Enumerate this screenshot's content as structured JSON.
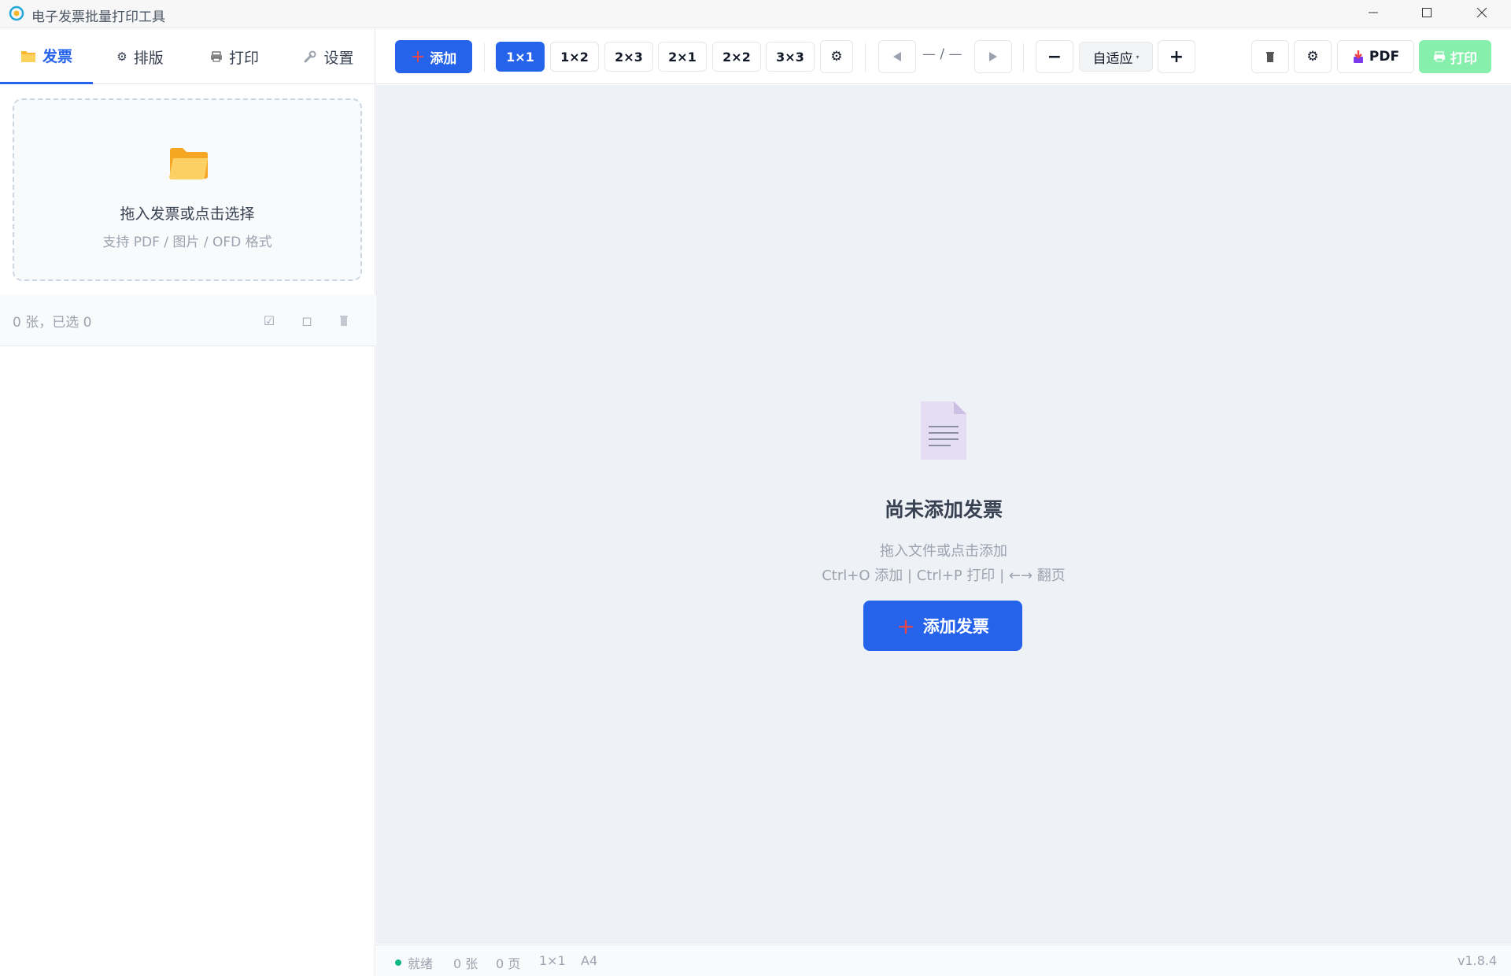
{
  "window": {
    "title": "电子发票批量打印工具"
  },
  "sidebar": {
    "tabs": [
      {
        "icon": "folder-icon",
        "label": "发票"
      },
      {
        "icon": "gear-icon",
        "label": "排版"
      },
      {
        "icon": "printer-icon",
        "label": "打印"
      },
      {
        "icon": "wrench-icon",
        "label": "设置"
      }
    ],
    "dropzone": {
      "title": "拖入发票或点击选择",
      "subtitle": "支持 PDF / 图片 / OFD 格式"
    },
    "list": {
      "count_text": "0 张，已选 0"
    }
  },
  "toolbar": {
    "add_label": "添加",
    "layouts": [
      "1×1",
      "1×2",
      "2×3",
      "2×1",
      "2×2",
      "3×3"
    ],
    "active_layout": "1×1",
    "page_indicator": "— / —",
    "zoom": "自适应",
    "pdf_label": "PDF",
    "print_label": "打印"
  },
  "empty_state": {
    "title": "尚未添加发票",
    "hint": "拖入文件或点击添加",
    "shortcuts": "Ctrl+O 添加 | Ctrl+P 打印 | ←→ 翻页",
    "button_label": "添加发票"
  },
  "status": {
    "state": "就绪",
    "count": "0 张",
    "pages": "0 页",
    "layout": "1×1",
    "paper": "A4",
    "version": "v1.8.4"
  },
  "colors": {
    "primary": "#2563eb",
    "print_button": "#86efac",
    "canvas_bg": "#eef1f6",
    "status_ok": "#10b981"
  }
}
